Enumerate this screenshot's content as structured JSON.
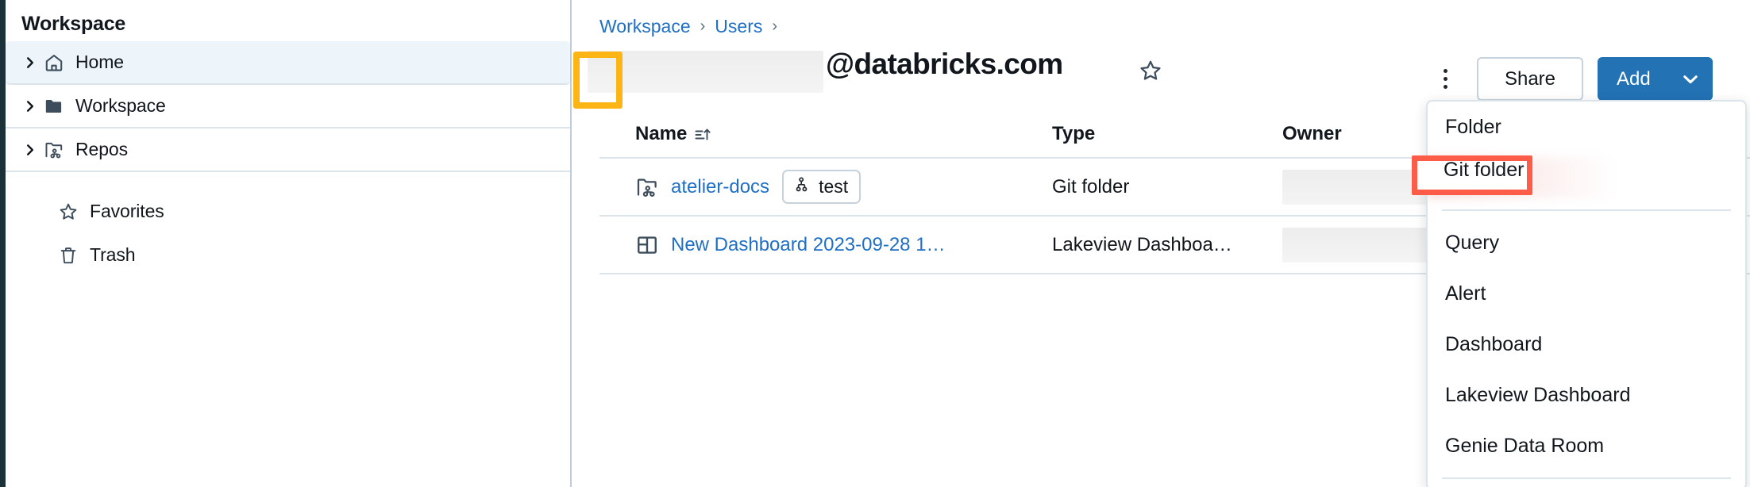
{
  "sidebar": {
    "title": "Workspace",
    "items": [
      {
        "label": "Home",
        "icon": "home-icon",
        "caret": true,
        "selected": true
      },
      {
        "label": "Workspace",
        "icon": "folder-icon",
        "caret": true,
        "selected": false
      },
      {
        "label": "Repos",
        "icon": "repo-folder-icon",
        "caret": true,
        "selected": false
      },
      {
        "label": "Favorites",
        "icon": "star-icon",
        "caret": false,
        "selected": false
      },
      {
        "label": "Trash",
        "icon": "trash-icon",
        "caret": false,
        "selected": false
      }
    ]
  },
  "breadcrumb": {
    "items": [
      "Workspace",
      "Users"
    ],
    "separator": "›"
  },
  "header": {
    "title": "@databricks.com",
    "redacted_prefix": true,
    "star_tooltip": "Favorite",
    "kebab_label": "More options",
    "share_label": "Share",
    "add_label": "Add",
    "add_caret": "⌄"
  },
  "table": {
    "columns": [
      "Name",
      "Type",
      "Owner"
    ],
    "sort_column": "Name",
    "sort_direction": "ascending",
    "rows": [
      {
        "name": "atelier-docs",
        "icon": "repo-folder-icon",
        "badge": "test",
        "badge_icon": "git-branch-icon",
        "type": "Git folder",
        "owner_redacted": true
      },
      {
        "name": "New Dashboard 2023-09-28 1…",
        "icon": "dashboard-icon",
        "badge": null,
        "badge_icon": null,
        "type": "Lakeview Dashboa…",
        "owner_redacted": true
      }
    ]
  },
  "add_menu": {
    "items": [
      {
        "label": "Folder",
        "highlighted": false,
        "divider_after": false
      },
      {
        "label": "Git folder",
        "highlighted": true,
        "divider_after": true
      },
      {
        "label": "Query",
        "highlighted": false,
        "divider_after": false
      },
      {
        "label": "Alert",
        "highlighted": false,
        "divider_after": false
      },
      {
        "label": "Dashboard",
        "highlighted": false,
        "divider_after": false
      },
      {
        "label": "Lakeview Dashboard",
        "highlighted": false,
        "divider_after": false
      },
      {
        "label": "Genie Data Room",
        "highlighted": false,
        "divider_after": true
      }
    ]
  },
  "annotations": {
    "add_caret_highlight_color": "#FDB515",
    "git_folder_highlight_color": "#FC5C48"
  },
  "colors": {
    "link": "#1F6FC4",
    "primary_button": "#2272B4",
    "rail": "#1B3139",
    "selected_row": "#EDF5FA",
    "border": "#DCE4EB"
  }
}
